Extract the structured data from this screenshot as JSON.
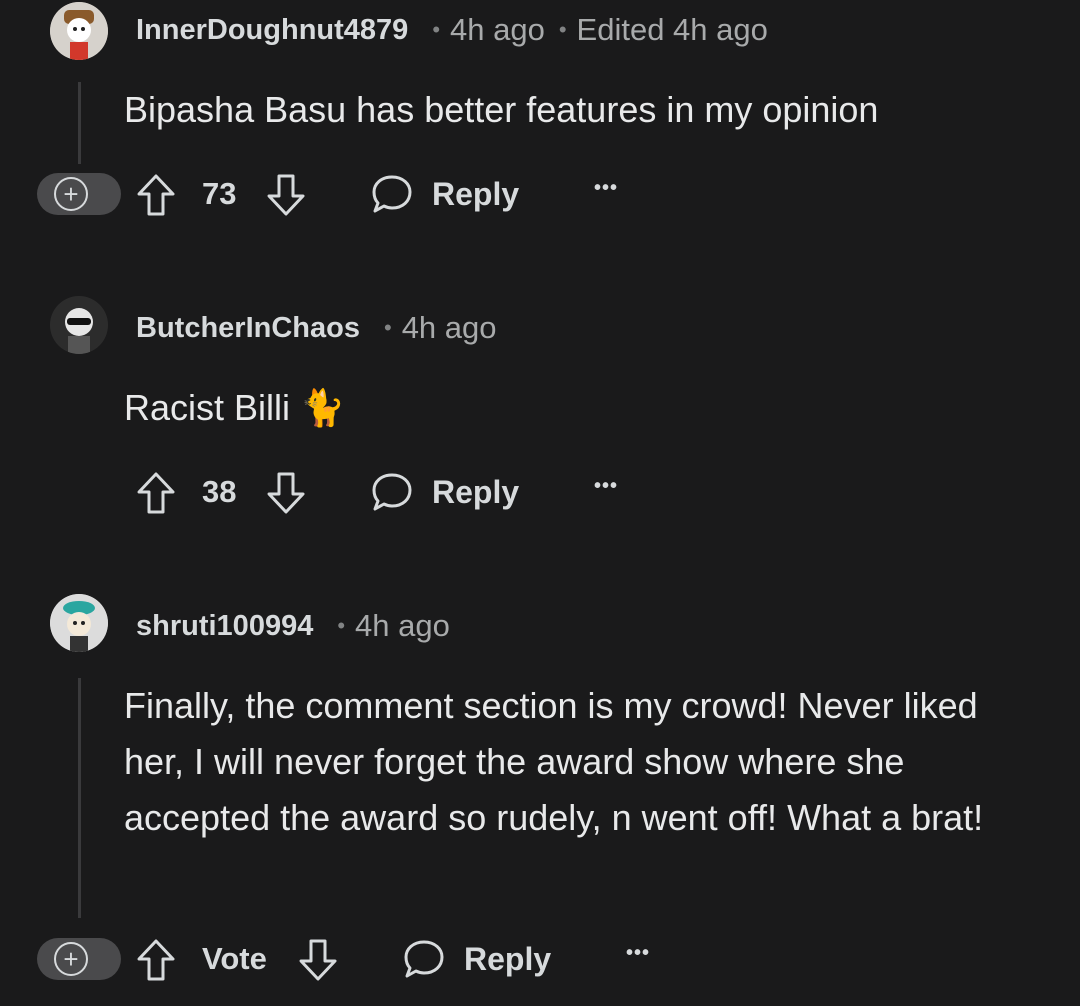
{
  "comments": [
    {
      "username": "InnerDoughnut4879",
      "time": "4h ago",
      "edited": "Edited 4h ago",
      "body": "Bipasha Basu has better features in my opinion",
      "votes": "73",
      "reply_label": "Reply",
      "more_label": "•••"
    },
    {
      "username": "ButcherInChaos",
      "time": "4h ago",
      "body": "Racist Billi 🐈",
      "votes": "38",
      "reply_label": "Reply",
      "more_label": "•••"
    },
    {
      "username": "shruti100994",
      "time": "4h ago",
      "body": "Finally, the comment section is my crowd! Never liked her, I will never forget the award show where she accepted the award so rudely, n went off! What a brat!",
      "votes": "Vote",
      "reply_label": "Reply",
      "more_label": "•••"
    }
  ],
  "icons": {
    "upvote": "arrow-up-outline-icon",
    "downvote": "arrow-down-outline-icon",
    "reply": "speech-bubble-icon",
    "expand": "plus-circle-icon"
  },
  "colors": {
    "background": "#1a1a1b",
    "text": "#d7dadc",
    "muted": "#818384",
    "thread_line": "#3a3a3c"
  }
}
